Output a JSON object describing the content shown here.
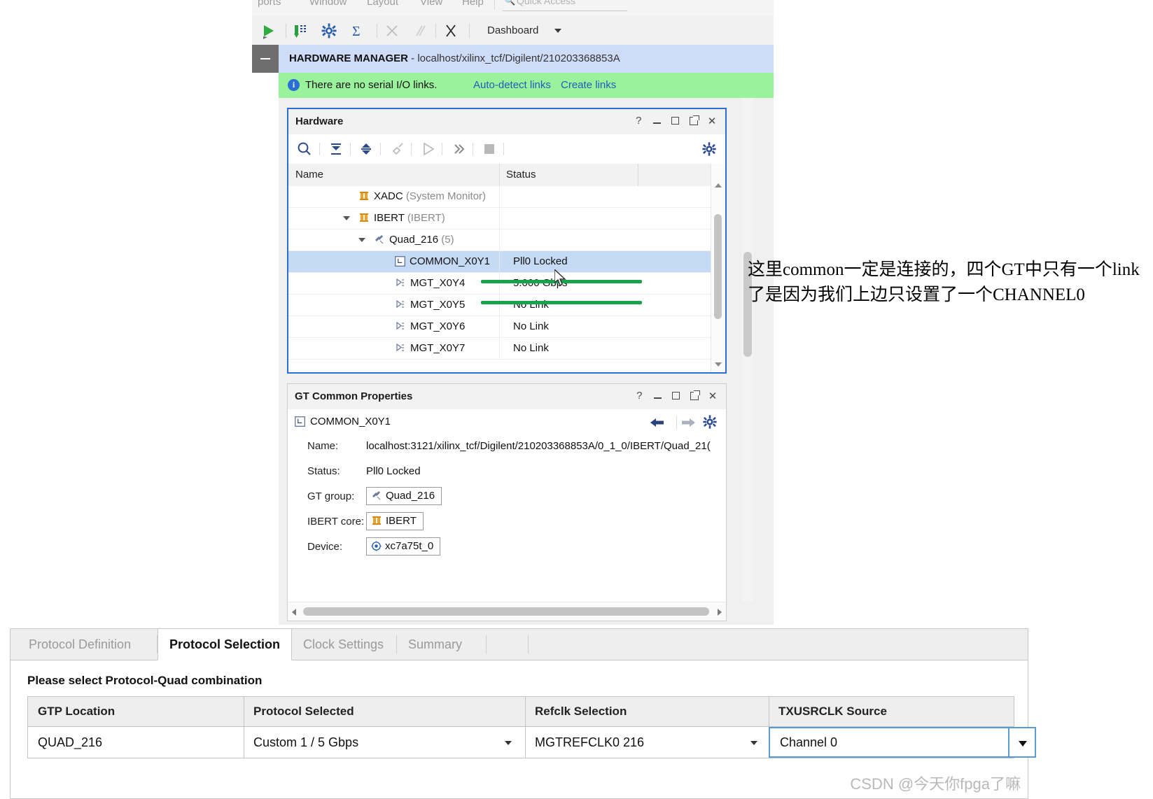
{
  "menu": {
    "items": [
      "ports",
      "Window",
      "Layout",
      "View",
      "Help"
    ],
    "quick_access_placeholder": "Quick Access",
    "search_icon": "search-icon"
  },
  "toolbar": {
    "icons": [
      "run-icon",
      "import-icon",
      "settings-gear-icon",
      "sigma-icon",
      "cut-disabled-icon",
      "copy-disabled-icon",
      "scissors-icon"
    ],
    "dashboard_label": "Dashboard"
  },
  "hardware_manager": {
    "title": "HARDWARE MANAGER",
    "target": "- localhost/xilinx_tcf/Digilent/210203368853A",
    "collapse_icon": "minimize-icon"
  },
  "link_banner": {
    "info_icon": "info-icon",
    "message": "There are no serial I/O links.",
    "links": [
      "Auto-detect links",
      "Create links"
    ]
  },
  "hardware_panel": {
    "title": "Hardware",
    "window_buttons": [
      "help-icon",
      "minimize-icon",
      "maximize-icon",
      "restore-icon",
      "close-icon"
    ],
    "toolbar_icons": [
      "search-icon",
      "collapse-all-icon",
      "expand-all-icon",
      "connect-disabled-icon",
      "run-disabled-icon",
      "more-icon",
      "stop-icon",
      "gear-icon"
    ],
    "columns": [
      "Name",
      "Status"
    ],
    "rows": [
      {
        "name": "XADC",
        "suffix": "(System Monitor)",
        "status": "",
        "indent": 100,
        "icon": "ibert-core-icon",
        "expander": "none",
        "selected": false
      },
      {
        "name": "IBERT",
        "suffix": "(IBERT)",
        "status": "",
        "indent": 100,
        "icon": "ibert-core-icon",
        "expander": "down",
        "selected": false
      },
      {
        "name": "Quad_216",
        "suffix": "(5)",
        "status": "",
        "indent": 122,
        "icon": "quad-icon",
        "expander": "down",
        "selected": false
      },
      {
        "name": "COMMON_X0Y1",
        "suffix": "",
        "status": "Pll0 Locked",
        "indent": 152,
        "icon": "common-icon",
        "expander": "none",
        "selected": true
      },
      {
        "name": "MGT_X0Y4",
        "suffix": "",
        "status": "5.000 Gbps",
        "indent": 152,
        "icon": "mgt-icon",
        "expander": "none",
        "selected": false
      },
      {
        "name": "MGT_X0Y5",
        "suffix": "",
        "status": "No Link",
        "indent": 152,
        "icon": "mgt-icon",
        "expander": "none",
        "selected": false
      },
      {
        "name": "MGT_X0Y6",
        "suffix": "",
        "status": "No Link",
        "indent": 152,
        "icon": "mgt-icon",
        "expander": "none",
        "selected": false
      },
      {
        "name": "MGT_X0Y7",
        "suffix": "",
        "status": "No Link",
        "indent": 152,
        "icon": "mgt-icon",
        "expander": "none",
        "selected": false
      }
    ],
    "highlight_color": "#16a34a"
  },
  "gt_common_properties": {
    "title": "GT Common Properties",
    "window_buttons": [
      "help-icon",
      "minimize-icon",
      "maximize-icon",
      "restore-icon",
      "close-icon"
    ],
    "selected_object": "COMMON_X0Y1",
    "nav_icons": [
      "back-arrow-icon",
      "forward-arrow-icon",
      "gear-icon"
    ],
    "fields": [
      {
        "label": "Name:",
        "value": "localhost:3121/xilinx_tcf/Digilent/210203368853A/0_1_0/IBERT/Quad_21(",
        "chip": false
      },
      {
        "label": "Status:",
        "value": "Pll0 Locked",
        "chip": false
      },
      {
        "label": "GT group:",
        "value": "Quad_216",
        "chip": true,
        "icon": "quad-icon"
      },
      {
        "label": "IBERT core:",
        "value": "IBERT",
        "chip": true,
        "icon": "ibert-core-icon"
      },
      {
        "label": "Device:",
        "value": "xc7a75t_0",
        "chip": true,
        "icon": "device-icon"
      }
    ]
  },
  "annotation": {
    "text": "这里common一定是连接的，四个GT中只有一个link了是因为我们上边只设置了一个CHANNEL0"
  },
  "wizard": {
    "tabs": [
      {
        "label": "Protocol Definition",
        "active": false
      },
      {
        "label": "Protocol Selection",
        "active": true
      },
      {
        "label": "Clock Settings",
        "active": false
      },
      {
        "label": "Summary",
        "active": false
      }
    ],
    "hint": "Please select Protocol-Quad combination",
    "table": {
      "columns": [
        "GTP Location",
        "Protocol Selected",
        "Refclk Selection",
        "TXUSRCLK Source"
      ],
      "rows": [
        {
          "gtp_location": "QUAD_216",
          "protocol_selected": "Custom 1 / 5 Gbps",
          "refclk_selection": "MGTREFCLK0 216",
          "txusrclk_source": "Channel 0"
        }
      ]
    }
  },
  "watermark": "CSDN @今天你fpga了嘛"
}
